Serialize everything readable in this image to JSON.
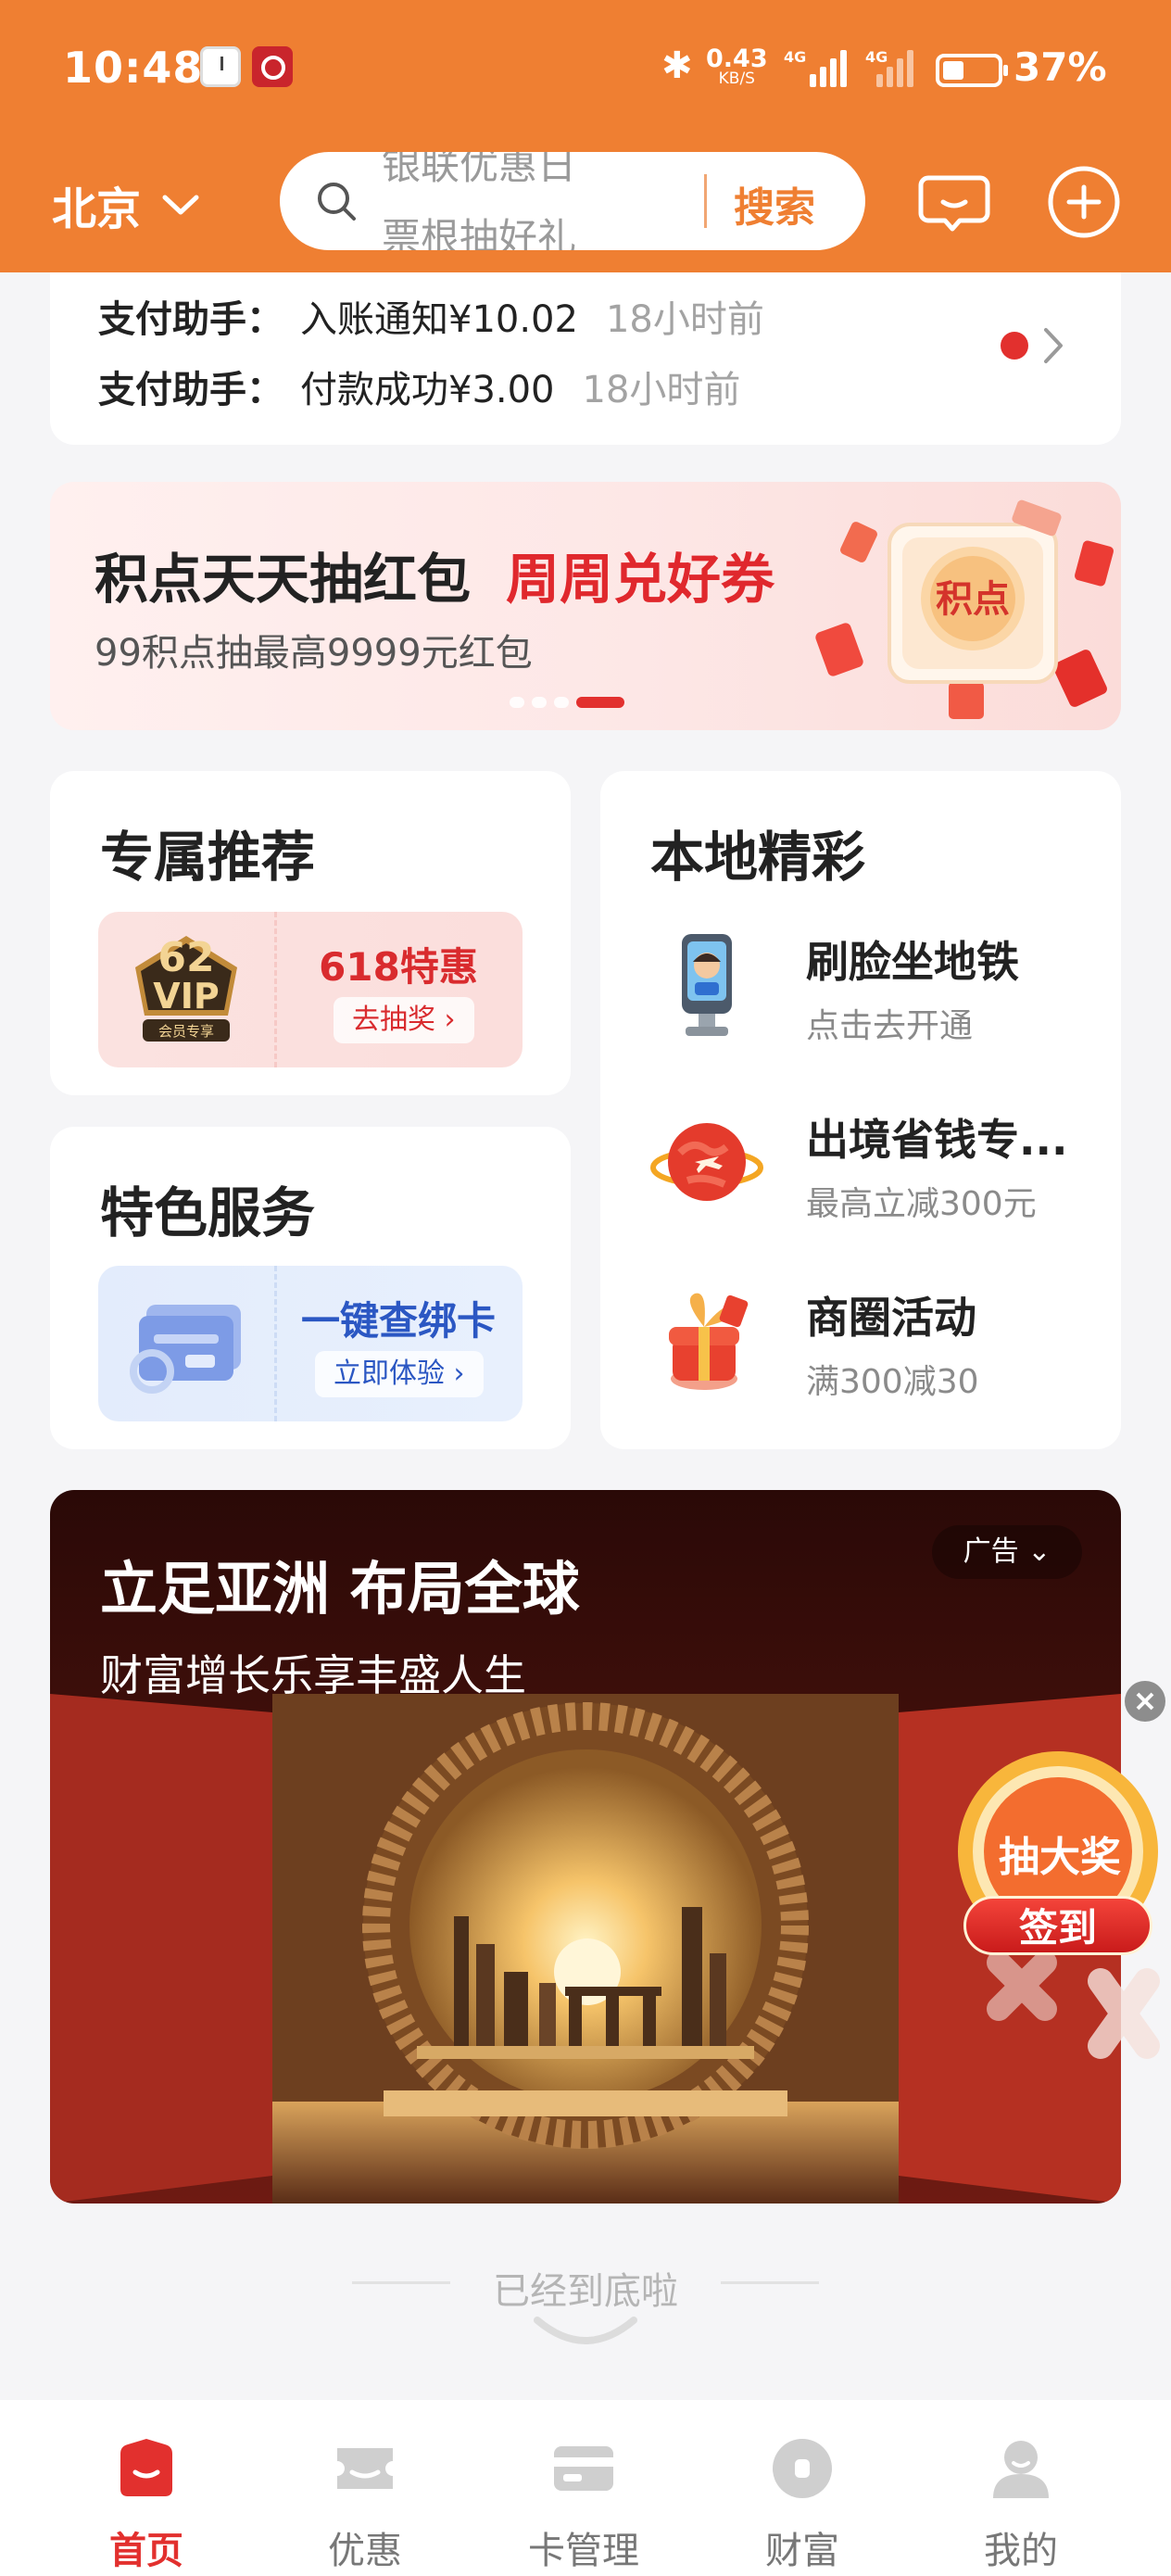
{
  "status_bar": {
    "time": "10:48",
    "speed_value": "0.43",
    "speed_unit": "KB/S",
    "network_1": "4G",
    "network_2": "4G",
    "battery": "37%"
  },
  "header": {
    "city": "北京",
    "search_rolling_prev": "银联优惠日",
    "search_rolling_next": "票根抽好礼",
    "search_button": "搜索",
    "accent_color": "#ef7f32"
  },
  "notices": [
    {
      "label": "支付助手：",
      "text": "入账通知¥10.02",
      "time": "18小时前"
    },
    {
      "label": "支付助手：",
      "text": "付款成功¥3.00",
      "time": "18小时前"
    }
  ],
  "banner": {
    "title_part1": "积点天天抽红包",
    "title_part2": "周周兑好券",
    "subtitle": "99积点抽最高9999元红包",
    "badge": "积点"
  },
  "exclusive": {
    "title": "专属推荐",
    "badge_number": "62",
    "badge_vip": "VIP",
    "badge_caption": "会员专享",
    "promo_title": "618特惠",
    "promo_action": "去抽奖 ›"
  },
  "featured": {
    "title": "特色服务",
    "promo_title": "一键查绑卡",
    "promo_action": "立即体验 ›"
  },
  "local": {
    "title": "本地精彩",
    "items": [
      {
        "title": "刷脸坐地铁",
        "subtitle": "点击去开通",
        "icon": "face-scan-kiosk-icon"
      },
      {
        "title": "出境省钱专...",
        "subtitle": "最高立减300元",
        "icon": "globe-airplane-icon"
      },
      {
        "title": "商圈活动",
        "subtitle": "满300减30",
        "icon": "gift-box-icon"
      }
    ]
  },
  "ad": {
    "headline": "立足亚洲 布局全球",
    "subline": "财富增长乐享丰盛人生",
    "tag": "广告"
  },
  "float_widget": {
    "title": "抽大奖",
    "button": "签到"
  },
  "footer": {
    "end_text": "已经到底啦"
  },
  "nav": [
    {
      "label": "首页",
      "icon": "home-icon",
      "active": true
    },
    {
      "label": "优惠",
      "icon": "ticket-icon",
      "active": false
    },
    {
      "label": "卡管理",
      "icon": "card-icon",
      "active": false
    },
    {
      "label": "财富",
      "icon": "coin-icon",
      "active": false
    },
    {
      "label": "我的",
      "icon": "profile-icon",
      "active": false
    }
  ]
}
